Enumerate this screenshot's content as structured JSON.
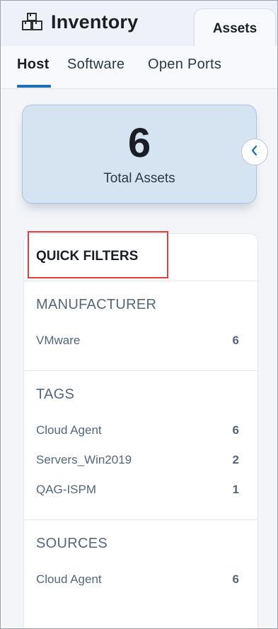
{
  "header": {
    "app_title": "Inventory",
    "app_icon": "inventory-boxes-icon",
    "tab_label": "Assets"
  },
  "subtabs": [
    {
      "label": "Host",
      "active": true
    },
    {
      "label": "Software",
      "active": false
    },
    {
      "label": "Open Ports",
      "active": false
    }
  ],
  "summary": {
    "total_value": "6",
    "total_label": "Total Assets",
    "collapse_icon": "chevron-left-icon"
  },
  "quick_filters": {
    "title": "QUICK FILTERS",
    "sections": [
      {
        "title": "MANUFACTURER",
        "items": [
          {
            "label": "VMware",
            "count": "6"
          }
        ]
      },
      {
        "title": "TAGS",
        "items": [
          {
            "label": "Cloud Agent",
            "count": "6"
          },
          {
            "label": "Servers_Win2019",
            "count": "2"
          },
          {
            "label": "QAG-ISPM",
            "count": "1"
          }
        ]
      },
      {
        "title": "SOURCES",
        "items": [
          {
            "label": "Cloud Agent",
            "count": "6"
          }
        ]
      }
    ]
  },
  "colors": {
    "accent": "#1d6fb8",
    "card_bg": "#d6e4f2",
    "highlight": "#e0413e"
  }
}
